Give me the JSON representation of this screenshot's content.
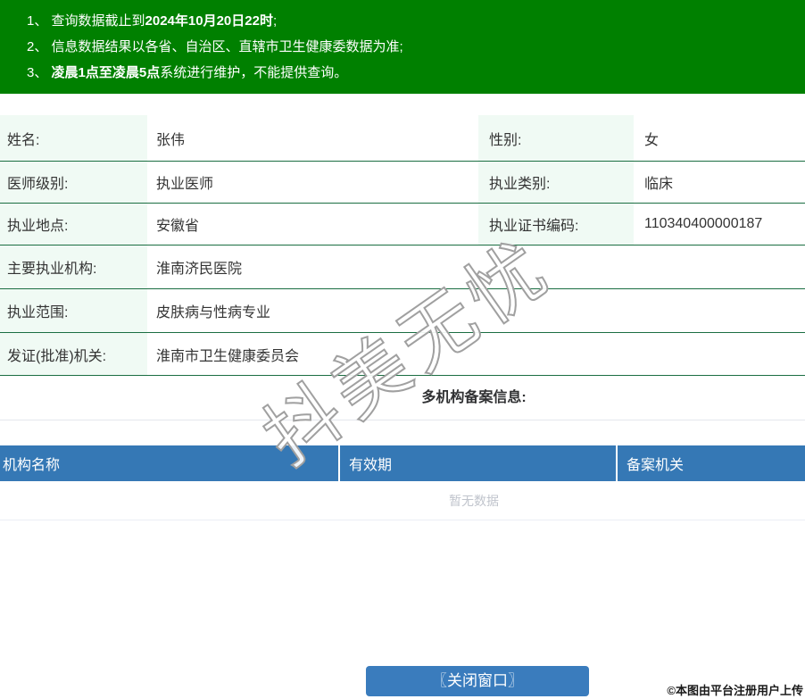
{
  "banner": {
    "bg_color": "#008000",
    "notices": [
      {
        "parts": [
          {
            "text": "1、 查询数据截止到"
          },
          {
            "bold": "2024年10月20日22时"
          },
          {
            "text": ";"
          }
        ]
      },
      {
        "parts": [
          {
            "text": "2、 信息数据结果以各省、自治区、直辖市卫生健康委数据为准;"
          },
          {
            "bold": ""
          },
          {
            "text": ""
          }
        ]
      },
      {
        "parts": [
          {
            "text": "3、 "
          },
          {
            "bold": "凌晨1点至凌晨5点"
          },
          {
            "text": "系统进行维护，不能提供查询。"
          }
        ]
      }
    ]
  },
  "info": {
    "label_bg": "#f0faf4",
    "divider_color": "#1b6e42",
    "rows": [
      {
        "label1": "姓名:",
        "value1": "张伟",
        "label2": "性别:",
        "value2": "女"
      },
      {
        "label1": "医师级别:",
        "value1": "执业医师",
        "label2": "执业类别:",
        "value2": "临床"
      },
      {
        "label1": "执业地点:",
        "value1": "安徽省",
        "label2": "执业证书编码:",
        "value2": "110340400000187"
      },
      {
        "label1": "主要执业机构:",
        "value1": "淮南济民医院"
      },
      {
        "label1": "执业范围:",
        "value1": "皮肤病与性病专业"
      },
      {
        "label1": "发证(批准)机关:",
        "value1": "淮南市卫生健康委员会"
      }
    ]
  },
  "backup_section": {
    "title": "多机构备案信息:",
    "header_bg": "#3578b5",
    "columns": [
      {
        "label": "机构名称"
      },
      {
        "label": "有效期"
      },
      {
        "label": "备案机关"
      }
    ],
    "empty_text": "暂无数据"
  },
  "watermark": {
    "text": "抖美无忧"
  },
  "footer": {
    "close_button_label": "〖关闭窗口〗",
    "close_button_color": "#3a7cbd",
    "credit_text": "©本图由平台注册用户上传"
  }
}
